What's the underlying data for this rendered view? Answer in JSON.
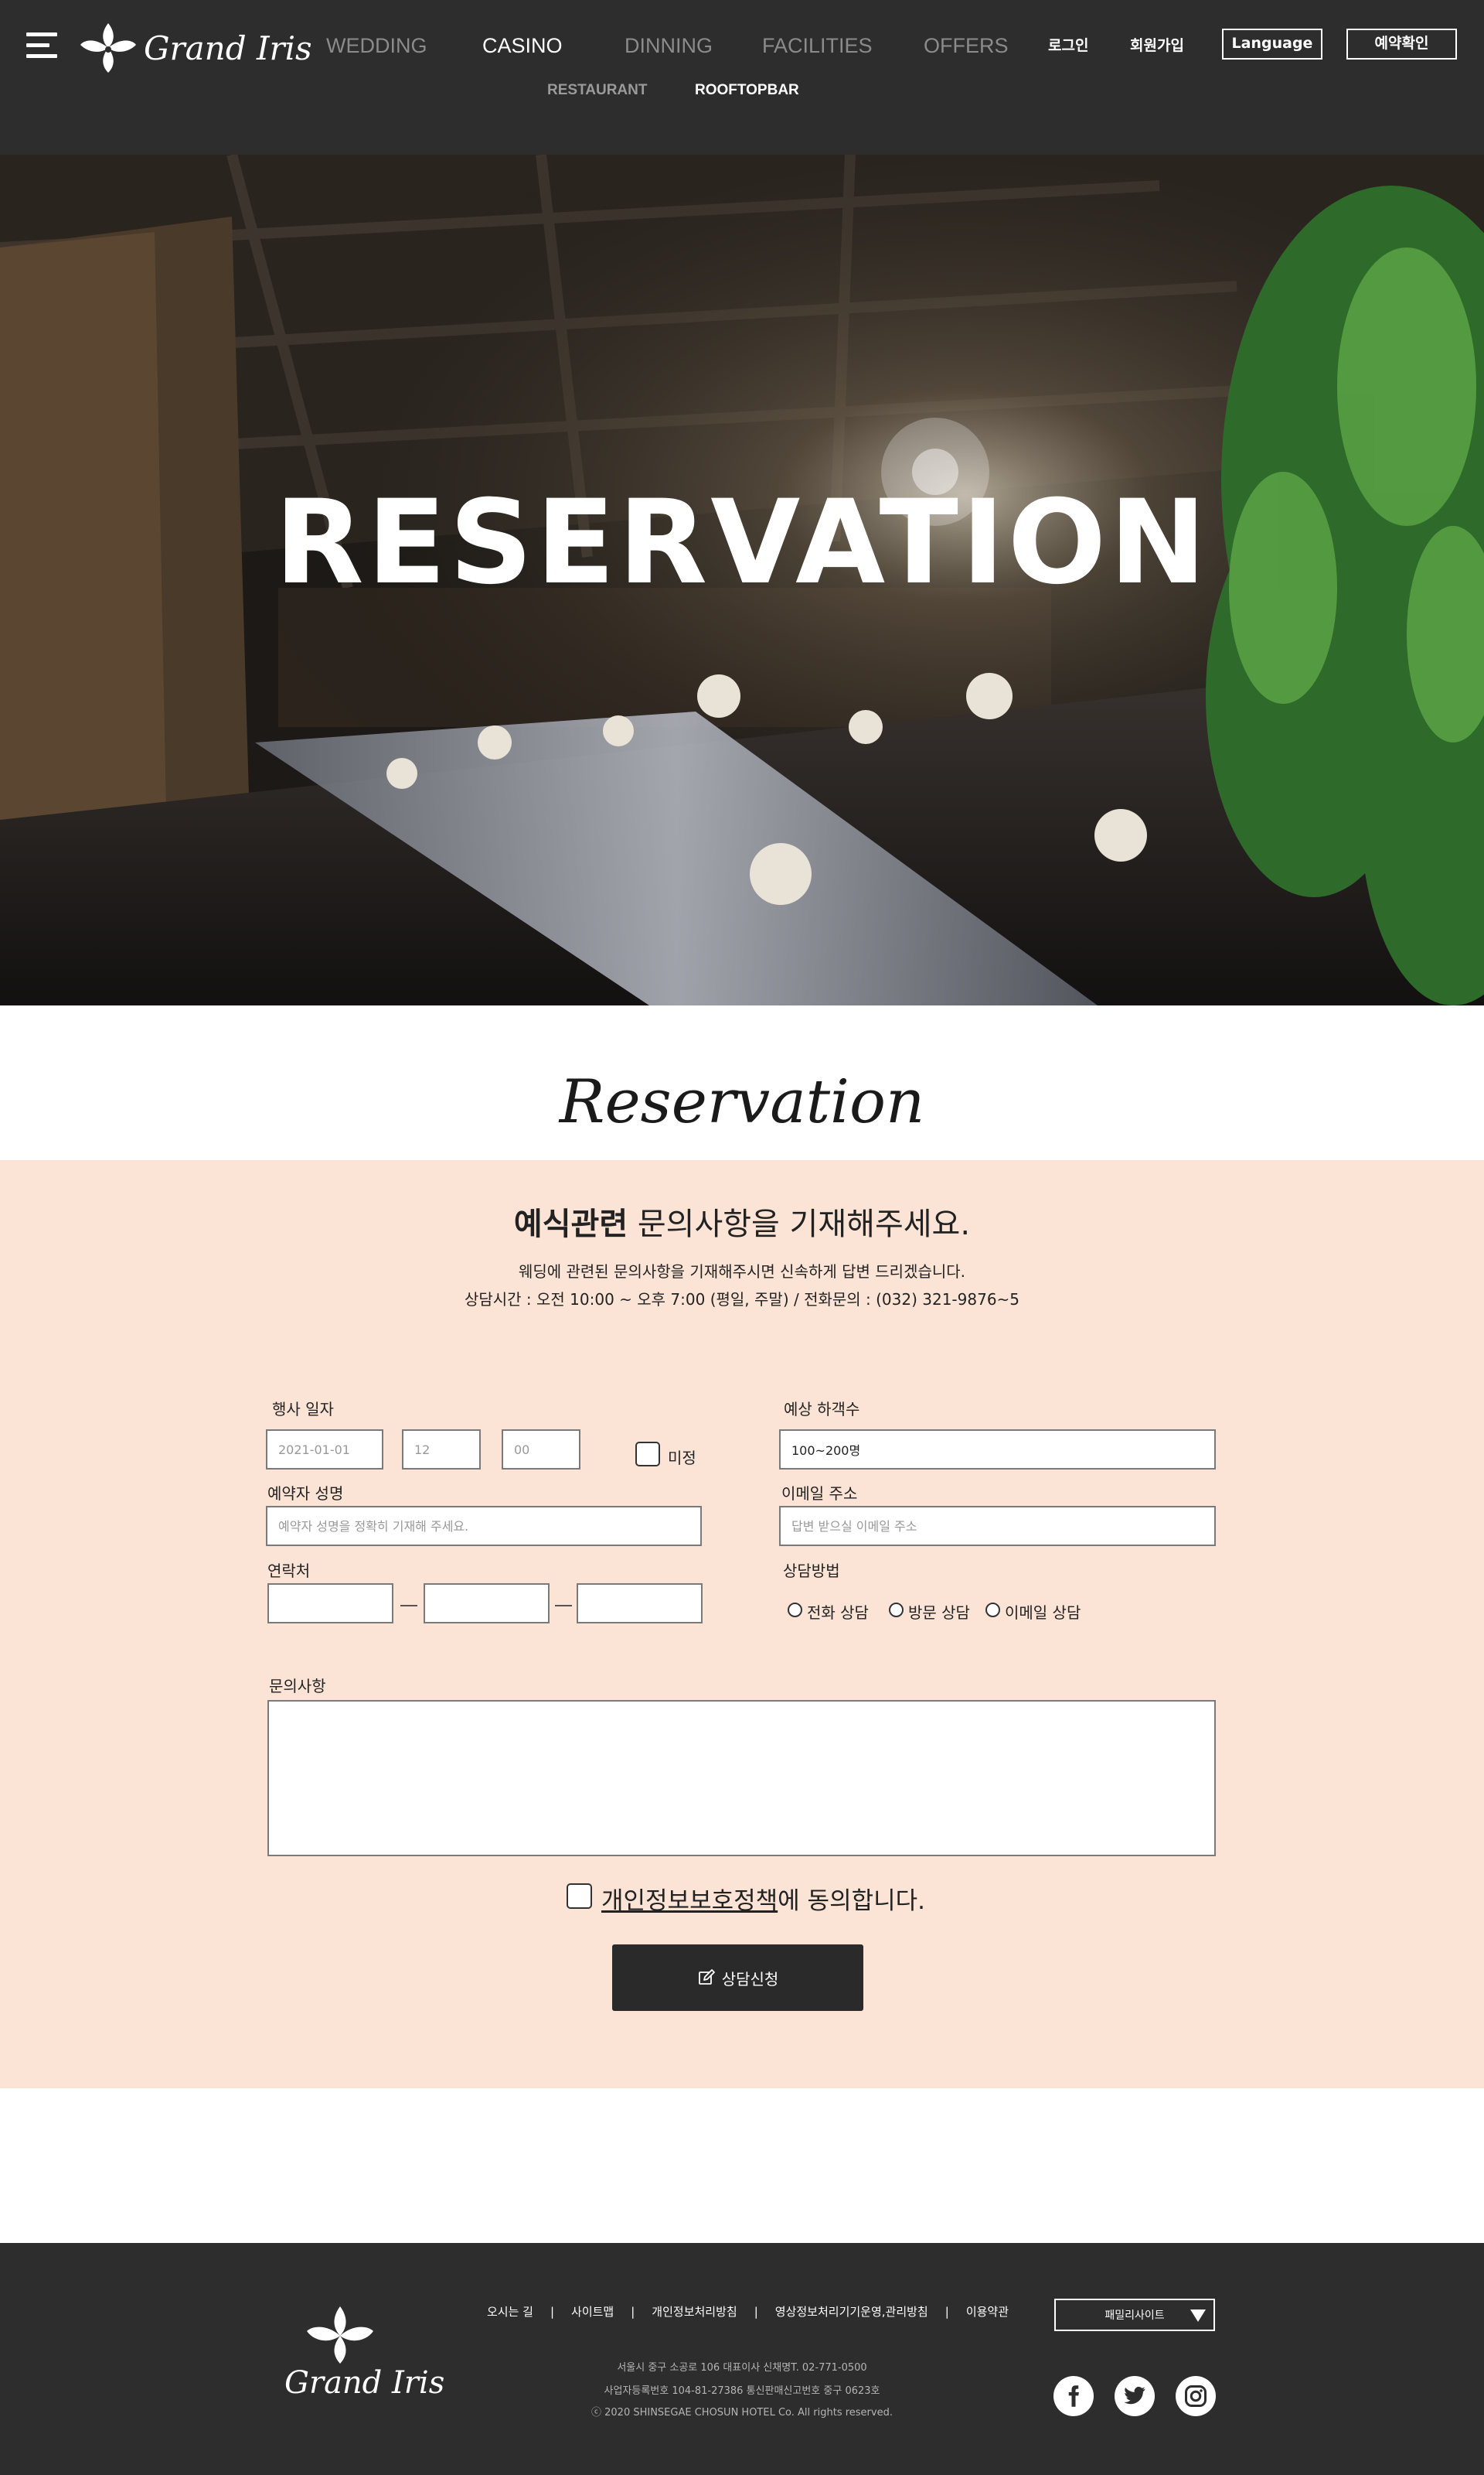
{
  "header": {
    "brand": "Grand Iris",
    "nav": [
      {
        "label": "WEDDING",
        "active": false
      },
      {
        "label": "CASINO",
        "active": true
      },
      {
        "label": "DINNING",
        "active": false
      },
      {
        "label": "FACILITIES",
        "active": false
      },
      {
        "label": "OFFERS",
        "active": false
      }
    ],
    "subnav": [
      {
        "label": "RESTAURANT",
        "active": false
      },
      {
        "label": "ROOFTOPBAR",
        "active": true
      }
    ],
    "login": "로그인",
    "signup": "회원가입",
    "language": "Language",
    "reservation_check": "예약확인"
  },
  "hero": {
    "title": "RESERVATION"
  },
  "section": {
    "script_title": "Reservation",
    "headline_bold": "예식관련",
    "headline_rest": " 문의사항을 기재해주세요.",
    "desc_line1": "웨딩에 관련된 문의사항을 기재해주시면 신속하게 답변 드리겠습니다.",
    "desc_line2": "상담시간 : 오전 10:00 ~ 오후 7:00 (평일, 주말) / 전화문의 : (032) 321-9876~5"
  },
  "form": {
    "event_date_label": "행사 일자",
    "date_placeholder": "2021-01-01",
    "hour_placeholder": "12",
    "minute_placeholder": "00",
    "undecided_label": "미정",
    "guests_label": "예상 하객수",
    "guests_value": "100~200명",
    "name_label": "예약자 성명",
    "name_placeholder": "예약자 성명을 정확히 기재해 주세요.",
    "email_label": "이메일 주소",
    "email_placeholder": "답변 받으실 이메일 주소",
    "phone_label": "연락처",
    "method_label": "상담방법",
    "methods": [
      "전화 상담",
      "방문 상담",
      "이메일 상담"
    ],
    "inquiry_label": "문의사항",
    "privacy_link": "개인정보보호정책",
    "privacy_rest": "에 동의합니다.",
    "submit_label": "상담신청"
  },
  "footer": {
    "brand": "Grand Iris",
    "links": [
      "오시는 길",
      "사이트맵",
      "개인정보처리방침",
      "영상정보처리기기운영,관리방침",
      "이용약관"
    ],
    "address": "서울시 중구 소공로 106 대표이사 신채명T. 02-771-0500",
    "business": "사업자등록번호 104-81-27386 통신판매신고번호 중구 0623호",
    "copyright": "ⓒ 2020 SHINSEGAE CHOSUN HOTEL Co. All rights reserved.",
    "family_site": "패밀리사이트",
    "sns": [
      "facebook-icon",
      "twitter-icon",
      "instagram-icon"
    ]
  }
}
